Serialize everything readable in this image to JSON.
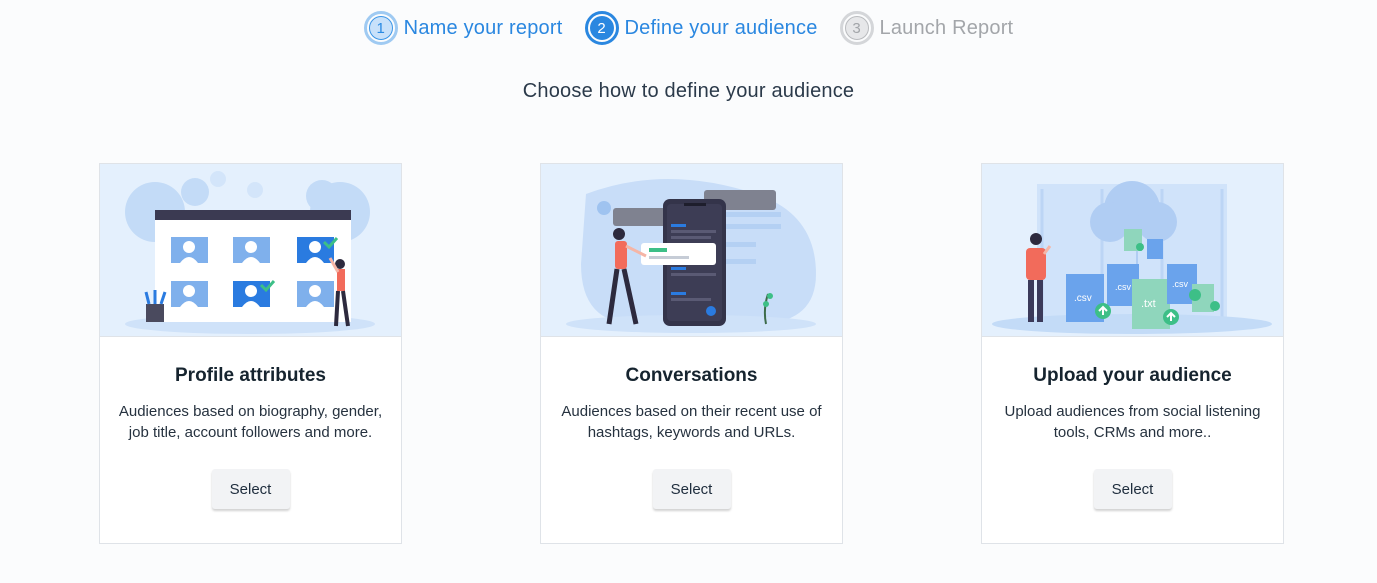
{
  "stepper": {
    "steps": [
      {
        "number": "1",
        "label": "Name your report",
        "state": "done"
      },
      {
        "number": "2",
        "label": "Define your audience",
        "state": "active"
      },
      {
        "number": "3",
        "label": "Launch Report",
        "state": "todo"
      }
    ]
  },
  "subtitle": "Choose how to define your audience",
  "cards": [
    {
      "title": "Profile attributes",
      "description": "Audiences based on biography, gender, job title, account followers and more.",
      "button": "Select",
      "illustration": "profile-grid-illustration"
    },
    {
      "title": "Conversations",
      "description": "Audiences based on their recent use of hashtags, keywords and URLs.",
      "button": "Select",
      "illustration": "phone-chat-illustration"
    },
    {
      "title": "Upload your audience",
      "description": "Upload audiences from social listening tools, CRMs and more..",
      "button": "Select",
      "illustration": "cloud-upload-illustration",
      "file_labels": [
        ".csv",
        ".csv",
        ".txt",
        ".csv"
      ]
    }
  ],
  "colors": {
    "accent": "#2a87e0",
    "inactive": "#a3a6aa",
    "illustration_bg": "#e4f0fd",
    "success": "#3dbf87"
  }
}
